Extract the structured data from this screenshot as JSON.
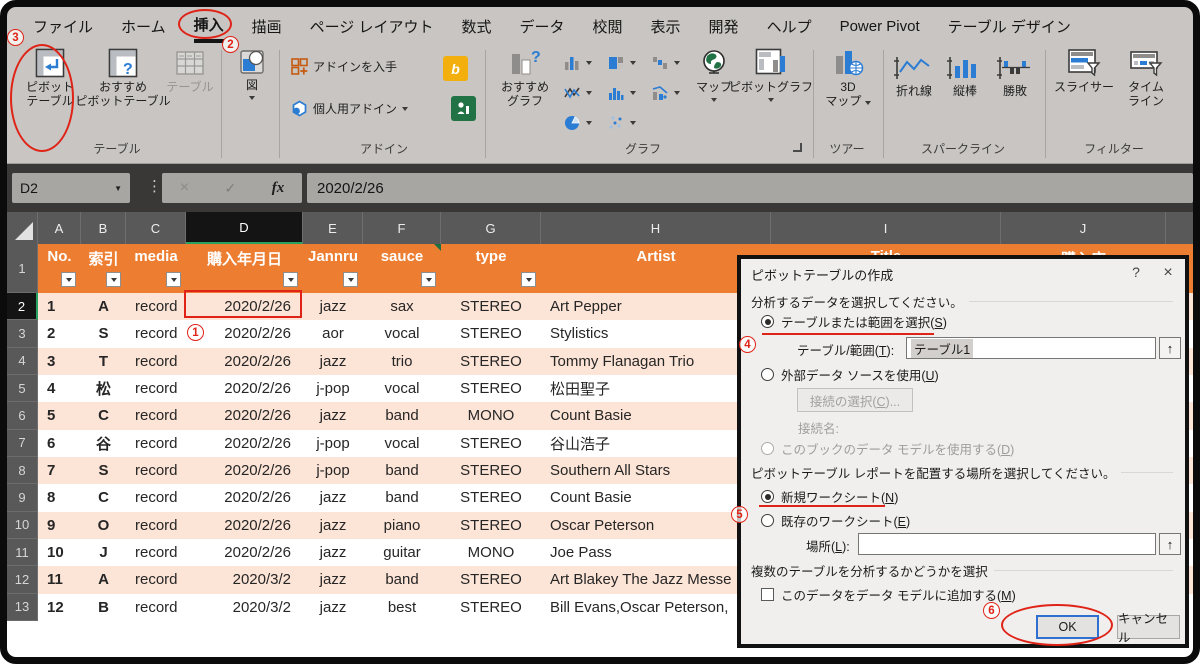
{
  "tabs": [
    {
      "label": "ファイル",
      "selected": false
    },
    {
      "label": "ホーム",
      "selected": false
    },
    {
      "label": "挿入",
      "selected": true
    },
    {
      "label": "描画",
      "selected": false
    },
    {
      "label": "ページ レイアウト",
      "selected": false
    },
    {
      "label": "数式",
      "selected": false
    },
    {
      "label": "データ",
      "selected": false
    },
    {
      "label": "校閲",
      "selected": false
    },
    {
      "label": "表示",
      "selected": false
    },
    {
      "label": "開発",
      "selected": false
    },
    {
      "label": "ヘルプ",
      "selected": false
    },
    {
      "label": "Power Pivot",
      "selected": false
    },
    {
      "label": "テーブル デザイン",
      "selected": false
    }
  ],
  "ribbon": {
    "tables": {
      "label": "テーブル",
      "pivot": [
        "ピボット",
        "テーブル"
      ],
      "recommended": [
        "おすすめ",
        "ピボットテーブル"
      ],
      "table": "テーブル"
    },
    "illustrations": {
      "button": "図"
    },
    "addins": {
      "label": "アドイン",
      "get": "アドインを入手",
      "personal": "個人用アドイン",
      "bing": "b"
    },
    "charts": {
      "label": "グラフ",
      "recommended": [
        "おすすめ",
        "グラフ"
      ],
      "map": "マップ",
      "pivotchart": "ピボットグラフ"
    },
    "tours": {
      "label": "ツアー",
      "map3d": [
        "3D",
        "マップ"
      ]
    },
    "sparklines": {
      "label": "スパークライン",
      "line": "折れ線",
      "column": "縦棒",
      "winloss": "勝敗"
    },
    "filters": {
      "label": "フィルター",
      "slicer": "スライサー",
      "timeline": [
        "タイム",
        "ライン"
      ]
    }
  },
  "formula_bar": {
    "name_box": "D2",
    "cancel": "×",
    "enter": "✓",
    "fx": "fx",
    "value": "2020/2/26",
    "dots": "⋮",
    "arrow": "▼"
  },
  "sheet": {
    "col_letters": [
      "A",
      "B",
      "C",
      "D",
      "E",
      "F",
      "G",
      "H",
      "I",
      "J"
    ],
    "row1_number": "1",
    "headers": [
      "No.",
      "索引",
      "media",
      "購入年月日",
      "Jannru",
      "sauce",
      "type",
      "Artist",
      "Title",
      "購入店"
    ],
    "rows": [
      {
        "r": "2",
        "cells": [
          "1",
          "A",
          "record",
          "2020/2/26",
          "jazz",
          "sax",
          "STEREO",
          "Art Pepper"
        ]
      },
      {
        "r": "3",
        "cells": [
          "2",
          "S",
          "record",
          "2020/2/26",
          "aor",
          "vocal",
          "STEREO",
          "Stylistics"
        ]
      },
      {
        "r": "4",
        "cells": [
          "3",
          "T",
          "record",
          "2020/2/26",
          "jazz",
          "trio",
          "STEREO",
          "Tommy Flanagan Trio"
        ]
      },
      {
        "r": "5",
        "cells": [
          "4",
          "松",
          "record",
          "2020/2/26",
          "j-pop",
          "vocal",
          "STEREO",
          "松田聖子"
        ]
      },
      {
        "r": "6",
        "cells": [
          "5",
          "C",
          "record",
          "2020/2/26",
          "jazz",
          "band",
          "MONO",
          "Count Basie"
        ]
      },
      {
        "r": "7",
        "cells": [
          "6",
          "谷",
          "record",
          "2020/2/26",
          "j-pop",
          "vocal",
          "STEREO",
          "谷山浩子"
        ]
      },
      {
        "r": "8",
        "cells": [
          "7",
          "S",
          "record",
          "2020/2/26",
          "j-pop",
          "band",
          "STEREO",
          "Southern All Stars"
        ]
      },
      {
        "r": "9",
        "cells": [
          "8",
          "C",
          "record",
          "2020/2/26",
          "jazz",
          "band",
          "STEREO",
          "Count Basie"
        ]
      },
      {
        "r": "10",
        "cells": [
          "9",
          "O",
          "record",
          "2020/2/26",
          "jazz",
          "piano",
          "STEREO",
          "Oscar Peterson"
        ]
      },
      {
        "r": "11",
        "cells": [
          "10",
          "J",
          "record",
          "2020/2/26",
          "jazz",
          "guitar",
          "MONO",
          "Joe Pass"
        ]
      },
      {
        "r": "12",
        "cells": [
          "11",
          "A",
          "record",
          "2020/3/2",
          "jazz",
          "band",
          "STEREO",
          "Art Blakey The Jazz Messe"
        ]
      },
      {
        "r": "13",
        "cells": [
          "12",
          "B",
          "record",
          "2020/3/2",
          "jazz",
          "best",
          "STEREO",
          "Bill Evans,Oscar Peterson,"
        ]
      }
    ]
  },
  "dialog": {
    "title": "ピボットテーブルの作成",
    "help": "?",
    "close": "×",
    "section_source": "分析するデータを選択してください。",
    "radio_table_range": "テーブルまたは範囲を選択(S)",
    "table_range_label": "テーブル/範囲(T):",
    "table_range_value": "テーブル1",
    "radio_external": "外部データ ソースを使用(U)",
    "choose_connection": "接続の選択(C)...",
    "connection_name": "接続名:",
    "radio_data_model": "このブックのデータ モデルを使用する(D)",
    "section_place": "ピボットテーブル レポートを配置する場所を選択してください。",
    "radio_new_sheet": "新規ワークシート(N)",
    "radio_existing_sheet": "既存のワークシート(E)",
    "location_label": "場所(L):",
    "location_value": "",
    "section_multi": "複数のテーブルを分析するかどうかを選択",
    "checkbox_add_model": "このデータをデータ モデルに追加する(M)",
    "ok": "OK",
    "cancel": "キャンセル",
    "range_picker": "↑"
  },
  "annotations": {
    "n1": "1",
    "n2": "2",
    "n3": "3",
    "n4": "4",
    "n5": "5",
    "n6": "6"
  },
  "colors": {
    "header_orange": "#ED7D31",
    "band_peach": "#FCE4D6",
    "annotation_red": "#E02317",
    "selection_green": "#27A35F"
  }
}
